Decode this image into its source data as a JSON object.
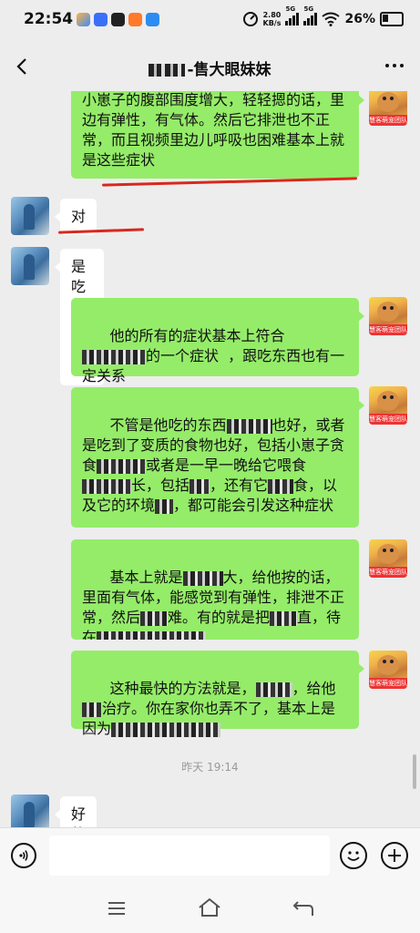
{
  "status_bar": {
    "time": "22:54",
    "net_speed": "2.80",
    "net_unit": "KB/s",
    "signal1": "5G",
    "signal2": "5G",
    "battery": "26%"
  },
  "header": {
    "title": "-售大眼妹妹"
  },
  "avatars": {
    "self_badge": "慧客萌宠团队"
  },
  "messages": [
    {
      "side": "out",
      "text": "小崽子的腹部围度增大，轻轻摁的话，里边有弹性，有气体。然后它排泄也不正常，而且视频里边儿呼吸也困难基本上就是这些症状"
    },
    {
      "side": "in",
      "text": "对"
    },
    {
      "side": "in",
      "text": "是吃错东西吗?"
    },
    {
      "side": "out",
      "parts": [
        "他的所有的症状基本上符合",
        "的一个症状  ，跟吃东西也有一定关系"
      ]
    },
    {
      "side": "out",
      "parts": [
        "不管是他吃的东西",
        "也好，或者是吃到了变质的食物也好，包括小崽子贪食",
        "或者是一早一晚给它喂食",
        "长，包括",
        "，还有它",
        "食，以及它的环境",
        "，都可能会引发这种症状"
      ]
    },
    {
      "side": "out",
      "parts": [
        "基本上就是",
        "大，给他按的话，里面有气体，能感觉到有弹性，排泄不正常，然后",
        "难。有的就是把",
        "直，待在"
      ]
    },
    {
      "side": "out",
      "parts": [
        "这种最快的方法就是，",
        "，给他",
        "治疗。你在家你也弄不了，基本上是因为"
      ]
    },
    {
      "side": "time",
      "text": "昨天 19:14"
    },
    {
      "side": "in",
      "text": "好的"
    }
  ],
  "colors": {
    "out_bubble": "#95ec69",
    "in_bubble": "#ffffff",
    "background": "#ededed",
    "annotation": "#d9271d"
  }
}
